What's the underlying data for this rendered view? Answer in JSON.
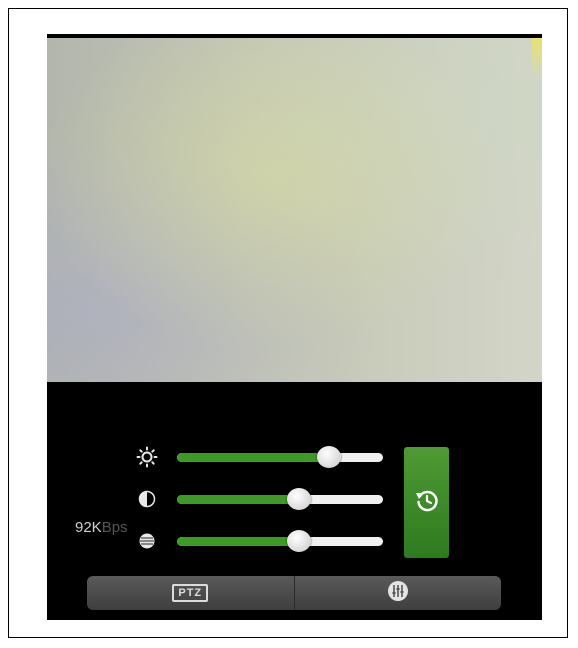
{
  "video": {},
  "controls": {
    "sliders": [
      {
        "name": "brightness",
        "icon": "brightness-icon",
        "value": 0.74
      },
      {
        "name": "contrast",
        "icon": "contrast-icon",
        "value": 0.59
      },
      {
        "name": "saturation",
        "icon": "saturation-icon",
        "value": 0.59
      }
    ],
    "reset_icon": "history-reset-icon",
    "bitrate": {
      "value": "92K",
      "unit": "Bps"
    },
    "tabs": [
      {
        "label": "PTZ",
        "icon": "ptz-icon"
      },
      {
        "icon": "equalizer-icon"
      }
    ]
  },
  "colors": {
    "accent_green": "#3c9a25",
    "reset_button_green": "#2e7a1f",
    "track": "#f0f0f0",
    "background": "#000000"
  }
}
